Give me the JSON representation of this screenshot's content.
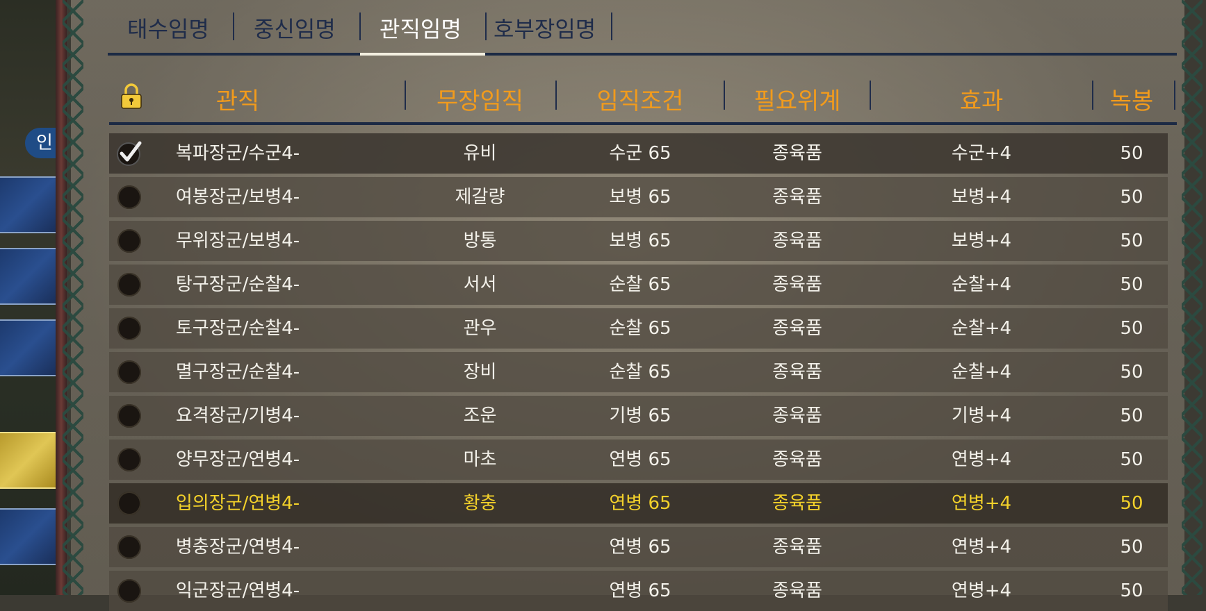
{
  "side": {
    "tab_label": "인"
  },
  "tabs": [
    {
      "label": "태수임명"
    },
    {
      "label": "중신임명"
    },
    {
      "label": "관직임명"
    },
    {
      "label": "호부장임명"
    }
  ],
  "table": {
    "headers": [
      "관직",
      "무장임직",
      "임직조건",
      "필요위계",
      "효과",
      "녹봉"
    ],
    "rows": [
      {
        "title": "복파장군/수군4-",
        "general": "유비",
        "condition": "수군 65",
        "rank": "종육품",
        "effect": "수군+4",
        "salary": "50",
        "state": "checked"
      },
      {
        "title": "여봉장군/보병4-",
        "general": "제갈량",
        "condition": "보병 65",
        "rank": "종육품",
        "effect": "보병+4",
        "salary": "50",
        "state": "empty"
      },
      {
        "title": "무위장군/보병4-",
        "general": "방통",
        "condition": "보병 65",
        "rank": "종육품",
        "effect": "보병+4",
        "salary": "50",
        "state": "empty"
      },
      {
        "title": "탕구장군/순찰4-",
        "general": "서서",
        "condition": "순찰 65",
        "rank": "종육품",
        "effect": "순찰+4",
        "salary": "50",
        "state": "empty"
      },
      {
        "title": "토구장군/순찰4-",
        "general": "관우",
        "condition": "순찰 65",
        "rank": "종육품",
        "effect": "순찰+4",
        "salary": "50",
        "state": "empty"
      },
      {
        "title": "멸구장군/순찰4-",
        "general": "장비",
        "condition": "순찰 65",
        "rank": "종육품",
        "effect": "순찰+4",
        "salary": "50",
        "state": "empty"
      },
      {
        "title": "요격장군/기병4-",
        "general": "조운",
        "condition": "기병 65",
        "rank": "종육품",
        "effect": "기병+4",
        "salary": "50",
        "state": "empty"
      },
      {
        "title": "양무장군/연병4-",
        "general": "마초",
        "condition": "연병 65",
        "rank": "종육품",
        "effect": "연병+4",
        "salary": "50",
        "state": "empty"
      },
      {
        "title": "입의장군/연병4-",
        "general": "황충",
        "condition": "연병 65",
        "rank": "종육품",
        "effect": "연병+4",
        "salary": "50",
        "state": "selected"
      },
      {
        "title": "병충장군/연병4-",
        "general": "",
        "condition": "연병 65",
        "rank": "종육품",
        "effect": "연병+4",
        "salary": "50",
        "state": "empty"
      },
      {
        "title": "익군장군/연병4-",
        "general": "",
        "condition": "연병 65",
        "rank": "종육품",
        "effect": "연병+4",
        "salary": "50",
        "state": "empty"
      }
    ]
  },
  "colors": {
    "header": "#f29b1c",
    "selected_text": "#f4d22a",
    "tab_text": "#1f2c4a"
  }
}
